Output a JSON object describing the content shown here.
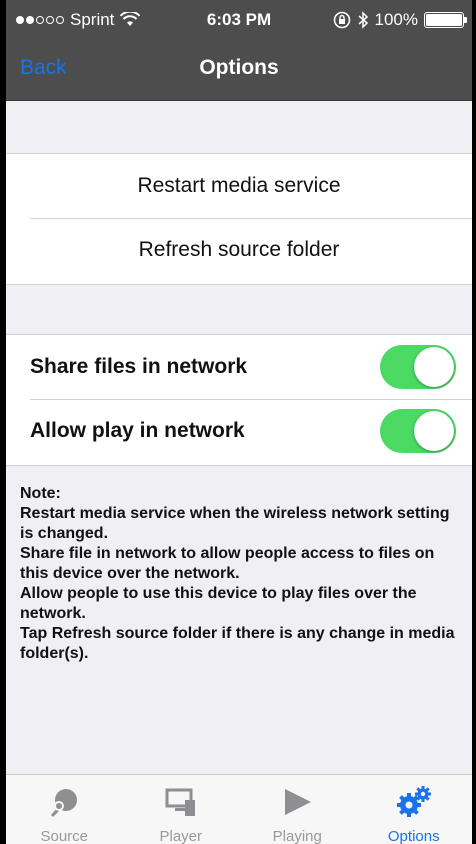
{
  "status_bar": {
    "carrier": "Sprint",
    "time": "6:03 PM",
    "battery": "100%"
  },
  "nav": {
    "back_label": "Back",
    "title": "Options"
  },
  "actions": [
    {
      "label": "Restart media service"
    },
    {
      "label": "Refresh source folder"
    }
  ],
  "toggles": [
    {
      "label": "Share files in network",
      "on": true
    },
    {
      "label": "Allow play in network",
      "on": true
    }
  ],
  "note": {
    "heading": "Note:",
    "lines": [
      "Restart media service when the wireless network setting is changed.",
      "Share file in network to allow people access to files on this device over the network.",
      "Allow people to use this device to play files over the network.",
      "Tap Refresh source folder if there is any change in media folder(s)."
    ]
  },
  "tabs": [
    {
      "label": "Source",
      "icon": "source-icon",
      "active": false
    },
    {
      "label": "Player",
      "icon": "player-icon",
      "active": false
    },
    {
      "label": "Playing",
      "icon": "play-icon",
      "active": false
    },
    {
      "label": "Options",
      "icon": "gears-icon",
      "active": true
    }
  ],
  "colors": {
    "accent": "#1a73e8",
    "toggle_on": "#4cd964",
    "bar": "#4d4d4d"
  }
}
